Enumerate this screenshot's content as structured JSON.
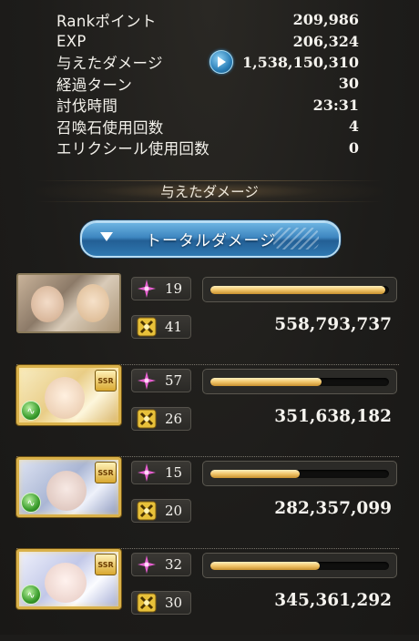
{
  "stats": [
    {
      "label": "Rankポイント",
      "value": "209,986"
    },
    {
      "label": "EXP",
      "value": "206,324"
    },
    {
      "label": "与えたダメージ",
      "value": "1,538,150,310",
      "icon": "play-icon"
    },
    {
      "label": "経過ターン",
      "value": "30"
    },
    {
      "label": "討伐時間",
      "value": "23:31"
    },
    {
      "label": "召喚石使用回数",
      "value": "4"
    },
    {
      "label": "エリクシール使用回数",
      "value": "0"
    }
  ],
  "section_title": "与えたダメージ",
  "dropdown": {
    "label": "トータルダメージ"
  },
  "members": [
    {
      "stat1": "19",
      "stat2": "41",
      "damage": "558,793,737",
      "bar": 0.98,
      "ssr": "",
      "element": ""
    },
    {
      "stat1": "57",
      "stat2": "26",
      "damage": "351,638,182",
      "bar": 0.62,
      "ssr": "SSR",
      "element": "wind"
    },
    {
      "stat1": "15",
      "stat2": "20",
      "damage": "282,357,099",
      "bar": 0.5,
      "ssr": "SSR",
      "element": "wind"
    },
    {
      "stat1": "32",
      "stat2": "30",
      "damage": "345,361,292",
      "bar": 0.61,
      "ssr": "SSR",
      "element": "wind"
    }
  ],
  "colors": {
    "accent_blue": "#3d86c0",
    "bar_gold": "#f1c56a",
    "skill_pink": "#e65fd0",
    "ca_gold": "#e8c13a"
  }
}
